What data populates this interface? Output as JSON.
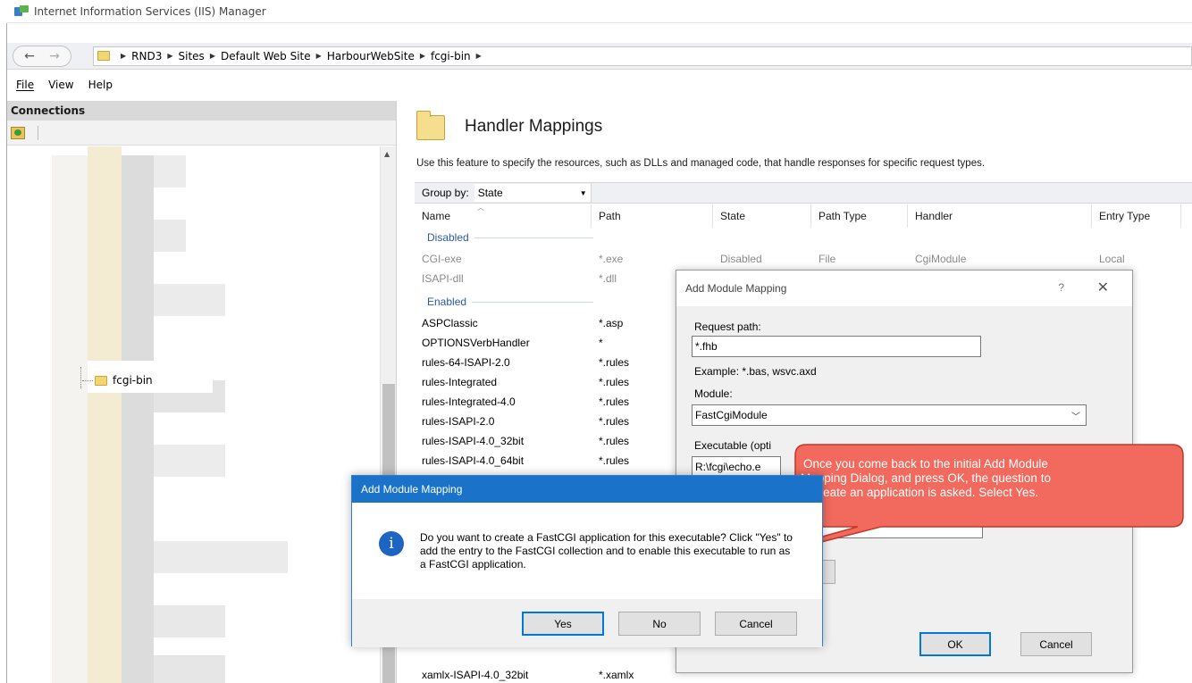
{
  "window": {
    "title": "Internet Information Services (IIS) Manager"
  },
  "navigation": {
    "back_glyph": "←",
    "forward_glyph": "→",
    "breadcrumbs": [
      "RND3",
      "Sites",
      "Default Web Site",
      "HarbourWebSite",
      "fcgi-bin"
    ]
  },
  "menu": {
    "items": [
      "File",
      "View",
      "Help"
    ]
  },
  "connections": {
    "header": "Connections",
    "tree_node": "fcgi-bin"
  },
  "feature": {
    "title": "Handler Mappings",
    "description": "Use this feature to specify the resources, such as DLLs and managed code, that handle responses for specific request types.",
    "group_by_label": "Group by:",
    "group_by_value": "State",
    "columns": [
      "Name",
      "Path",
      "State",
      "Path Type",
      "Handler",
      "Entry Type"
    ],
    "groups": {
      "disabled": "Disabled",
      "enabled": "Enabled"
    },
    "disabled_rows": [
      {
        "name": "CGI-exe",
        "path": "*.exe",
        "state": "Disabled",
        "path_type": "File",
        "handler": "CgiModule",
        "entry_type": "Local"
      },
      {
        "name": "ISAPI-dll",
        "path": "*.dll",
        "state": "",
        "path_type": "",
        "handler": "",
        "entry_type": ""
      }
    ],
    "enabled_rows": [
      {
        "name": "ASPClassic",
        "path": "*.asp"
      },
      {
        "name": "OPTIONSVerbHandler",
        "path": "*"
      },
      {
        "name": "rules-64-ISAPI-2.0",
        "path": "*.rules"
      },
      {
        "name": "rules-Integrated",
        "path": "*.rules"
      },
      {
        "name": "rules-Integrated-4.0",
        "path": "*.rules"
      },
      {
        "name": "rules-ISAPI-2.0",
        "path": "*.rules"
      },
      {
        "name": "rules-ISAPI-4.0_32bit",
        "path": "*.rules"
      },
      {
        "name": "rules-ISAPI-4.0_64bit",
        "path": "*.rules"
      }
    ],
    "bottom_rows": [
      {
        "name": "xamlx-ISAPI-4.0_32bit",
        "path": "*.xamlx"
      }
    ]
  },
  "add_module_dialog": {
    "title": "Add Module Mapping",
    "help_glyph": "?",
    "close_glyph": "✕",
    "request_path_label": "Request path:",
    "request_path_value": "*.fhb",
    "example_text": "Example: *.bas, wsvc.axd",
    "module_label": "Module:",
    "module_value": "FastCgiModule",
    "executable_label": "Executable (opti",
    "executable_value": "R:\\fcgi\\echo.e",
    "ok_label": "OK",
    "cancel_label": "Cancel"
  },
  "confirm_dialog": {
    "title": "Add Module Mapping",
    "icon_glyph": "i",
    "message": "Do you want to create a FastCGI application for this executable? Click \"Yes\" to add the entry to the FastCGI collection and to enable this executable to run as a FastCGI application.",
    "yes_label": "Yes",
    "no_label": "No",
    "cancel_label": "Cancel"
  },
  "callout": {
    "text": "Once you come back to the initial Add Module Mapping Dialog, and press OK, the question to create an application is asked. Select Yes.",
    "fill_color": "#f26a5e",
    "stroke_color": "#c0392b"
  }
}
